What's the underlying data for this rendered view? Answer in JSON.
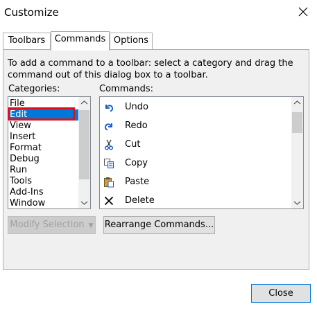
{
  "window": {
    "title": "Customize"
  },
  "tabs": [
    {
      "label": "Toolbars",
      "active": false
    },
    {
      "label": "Commands",
      "active": true
    },
    {
      "label": "Options",
      "active": false
    }
  ],
  "instructions": "To add a command to a toolbar: select a category and drag the command out of this dialog box to a toolbar.",
  "categories": {
    "label": "Categories:",
    "items": [
      "File",
      "Edit",
      "View",
      "Insert",
      "Format",
      "Debug",
      "Run",
      "Tools",
      "Add-Ins",
      "Window"
    ],
    "selected": "Edit"
  },
  "commands": {
    "label": "Commands:",
    "items": [
      {
        "label": "Undo",
        "icon": "undo-icon"
      },
      {
        "label": "Redo",
        "icon": "redo-icon"
      },
      {
        "label": "Cut",
        "icon": "scissors-icon"
      },
      {
        "label": "Copy",
        "icon": "copy-icon"
      },
      {
        "label": "Paste",
        "icon": "paste-icon"
      },
      {
        "label": "Delete",
        "icon": "delete-x-icon"
      }
    ]
  },
  "buttons": {
    "modify_selection": "Modify Selection",
    "rearrange_commands": "Rearrange Commands...",
    "close": "Close"
  },
  "colors": {
    "selection": "#0078d7",
    "highlight_outline": "#e2101c",
    "icon_blue": "#1f5fbf"
  }
}
